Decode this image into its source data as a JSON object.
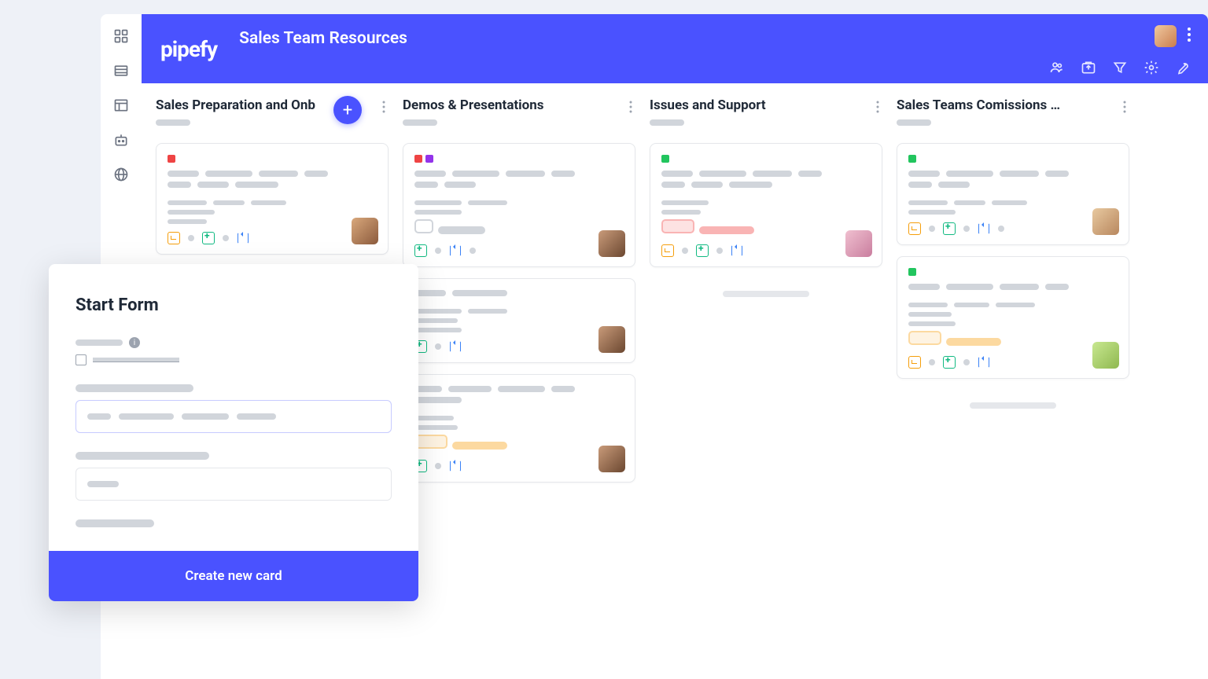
{
  "header": {
    "logo": "pipefy",
    "title": "Sales Team Resources"
  },
  "rail": {
    "items": [
      "apps",
      "table",
      "layout",
      "bot",
      "globe"
    ]
  },
  "header_tools": [
    "members",
    "inbox",
    "filter",
    "settings",
    "wrench"
  ],
  "columns": [
    {
      "title": "Sales Preparation and Onb",
      "has_add": true
    },
    {
      "title": "Demos & Presentations",
      "has_add": false
    },
    {
      "title": "Issues and Support",
      "has_add": false
    },
    {
      "title": "Sales Teams Comissions & Quot",
      "has_add": false
    }
  ],
  "modal": {
    "title": "Start Form",
    "submit": "Create new card"
  }
}
